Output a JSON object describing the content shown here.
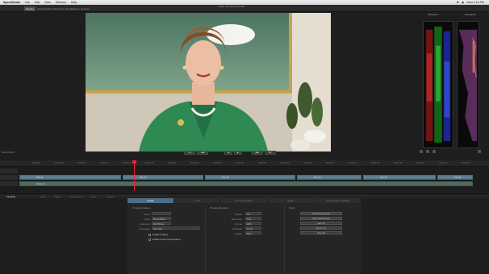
{
  "menubar": {
    "app": "SpeedGrade",
    "items": [
      "File",
      "Edit",
      "View",
      "Window",
      "Help"
    ],
    "right_status": [
      "⌘",
      "◉",
      "Wed 2:15 PM"
    ]
  },
  "window_title": "Adobe SpeedGrade CS6",
  "tabs": [
    "Monitor",
    "Media (Folder) Shared by Speech",
    "Desktop",
    "Desktop"
  ],
  "scopes": {
    "title_left": "Waveform",
    "title_right": "Histogram"
  },
  "viewer": {
    "timecode": "00:01:00:00"
  },
  "transport": {
    "buttons": [
      "|◀",
      "◀◀",
      "◀",
      "▶",
      "▶▶",
      "▶|"
    ]
  },
  "timeline": {
    "timecode_left": "00:01:00:00",
    "ruler_labels": [
      "00:00:00",
      "00:00:05",
      "00:00:10",
      "00:00:15",
      "00:00:20",
      "00:00:25",
      "00:00:30",
      "00:00:35",
      "00:00:40",
      "00:00:45",
      "00:00:50",
      "00:00:55",
      "00:01:00",
      "00:01:05",
      "00:01:10",
      "00:01:15",
      "00:01:20",
      "00:01:25",
      "00:01:30",
      "00:01:35"
    ],
    "clips": [
      {
        "name": "Clip_01",
        "track": "video"
      },
      {
        "name": "Clip_02",
        "track": "video"
      },
      {
        "name": "Clip_03",
        "track": "video"
      },
      {
        "name": "Clip_04",
        "track": "video"
      },
      {
        "name": "Clip_05",
        "track": "video"
      },
      {
        "name": "Clip_06",
        "track": "video"
      },
      {
        "name": "Audio_01",
        "track": "audio"
      }
    ]
  },
  "bottom_tabs": [
    "Timeline",
    "Look",
    "Mask",
    "Pan & Zoom",
    "Audio",
    "Output"
  ],
  "sub_tabs": [
    "Grade",
    "Look",
    "Format Renders",
    "Stereo",
    "Color Space Defaults"
  ],
  "properties": {
    "section1": "Timeline Options",
    "rows1": [
      {
        "label": "Name",
        "value": ""
      },
      {
        "label": "Origin",
        "value": "00:00:00:00"
      },
      {
        "label": "Framerate",
        "value": "23.976 fps"
      },
      {
        "label": "Colorspace",
        "value": "Rec.709"
      }
    ],
    "checks1": [
      "Enable Scaling",
      "Enable Level Compensation"
    ],
    "section2": "Timeline Renders",
    "rows2": [
      {
        "label": "Render",
        "value": "On"
      },
      {
        "label": "Resolution",
        "value": "Full"
      },
      {
        "label": "Format",
        "value": "DPX"
      },
      {
        "label": "Bit Depth",
        "value": "10 bit"
      },
      {
        "label": "Quality",
        "value": "Best"
      }
    ],
    "section3": "Tools",
    "buttons3": [
      "Load Shared Looks",
      "Save Shared Looks",
      "Load LUT",
      "Export LUT",
      "Reset All"
    ]
  }
}
